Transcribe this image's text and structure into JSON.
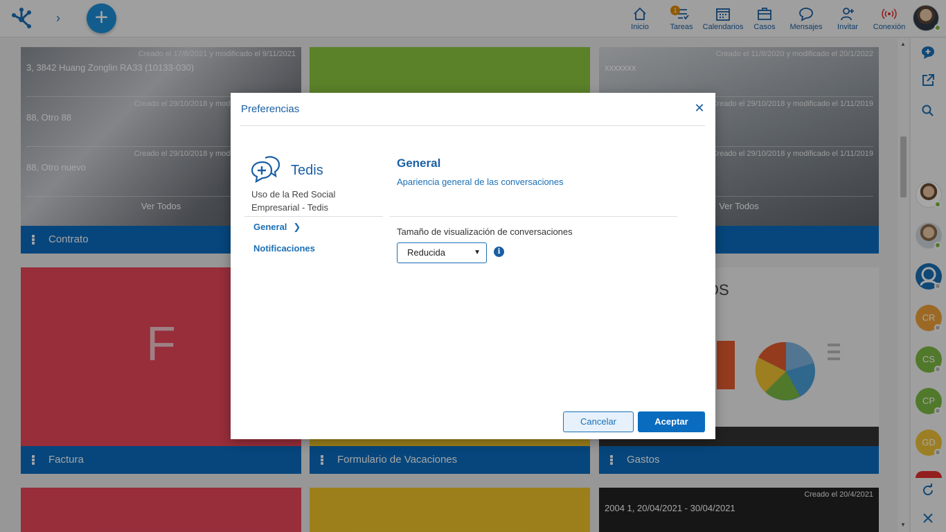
{
  "topbar": {
    "nav": [
      {
        "id": "inicio",
        "label": "Inicio",
        "icon": "home-icon"
      },
      {
        "id": "tareas",
        "label": "Tareas",
        "icon": "tasks-icon",
        "badge": "1"
      },
      {
        "id": "calendarios",
        "label": "Calendarios",
        "icon": "calendar-icon"
      },
      {
        "id": "casos",
        "label": "Casos",
        "icon": "briefcase-icon"
      },
      {
        "id": "mensajes",
        "label": "Mensajes",
        "icon": "chat-icon"
      },
      {
        "id": "invitar",
        "label": "Invitar",
        "icon": "add-user-icon"
      },
      {
        "id": "conexion",
        "label": "Conexión",
        "icon": "broadcast-icon"
      }
    ],
    "add_symbol": "+",
    "expand_symbol": "›"
  },
  "tiles": {
    "contrato": {
      "title": "Contrato",
      "rows": [
        {
          "meta": "Creado el 17/8/2021 y modificado el 9/11/2021",
          "text": "3, 3842 Huang Zonglin RA33 (10133-030)"
        },
        {
          "meta": "Creado el 29/10/2018 y modificado el 1/11/2019",
          "text": "88, Otro 88"
        },
        {
          "meta": "Creado el 29/10/2018 y modificado el 1/11/2019",
          "text": "88, Otro nuevo"
        }
      ],
      "ver_todos": "Ver Todos"
    },
    "tile2": {
      "title": ""
    },
    "tile3": {
      "rows": [
        {
          "meta": "Creado el 11/8/2020 y modificado el 20/1/2022",
          "text": "xxxxxxx"
        },
        {
          "meta": "Creado el 29/10/2018 y modificado el 1/11/2019",
          "text": ""
        },
        {
          "meta": "Creado el 29/10/2018 y modificado el 1/11/2019",
          "text": ""
        }
      ],
      "ver_todos": "Ver Todos"
    },
    "factura": {
      "title": "Factura",
      "letter": "F"
    },
    "vacaciones": {
      "title": "Formulario de Vacaciones"
    },
    "gastos": {
      "title": "Gastos",
      "image_text": "ROS"
    },
    "bottom_right": {
      "meta": "Creado el 20/4/2021",
      "text": "2004 1, 20/04/2021 - 30/04/2021"
    }
  },
  "sidebar": {
    "contacts": [
      {
        "initials": "CR",
        "color": "#f0a13a"
      },
      {
        "initials": "CS",
        "color": "#7dbb42"
      },
      {
        "initials": "CP",
        "color": "#7dbb42"
      },
      {
        "initials": "GD",
        "color": "#f0c43a"
      }
    ]
  },
  "dialog": {
    "title": "Preferencias",
    "close_symbol": "✕",
    "app_name": "Tedis",
    "app_desc": "Uso de la Red Social Empresarial - Tedis",
    "menu": [
      {
        "label": "General",
        "active": true
      },
      {
        "label": "Notificaciones",
        "active": false
      }
    ],
    "section_title": "General",
    "section_subtitle": "Apariencia general de las conversaciones",
    "field_label": "Tamaño de visualización de conversaciones",
    "field_value": "Reducida",
    "info_symbol": "i",
    "cancel_label": "Cancelar",
    "ok_label": "Aceptar"
  },
  "colors": {
    "primary": "#0a6cbf",
    "link": "#1a6fb5",
    "factura_red": "#e8475a",
    "vacaciones_yellow": "#f0c42a",
    "green": "#8cc63f"
  }
}
